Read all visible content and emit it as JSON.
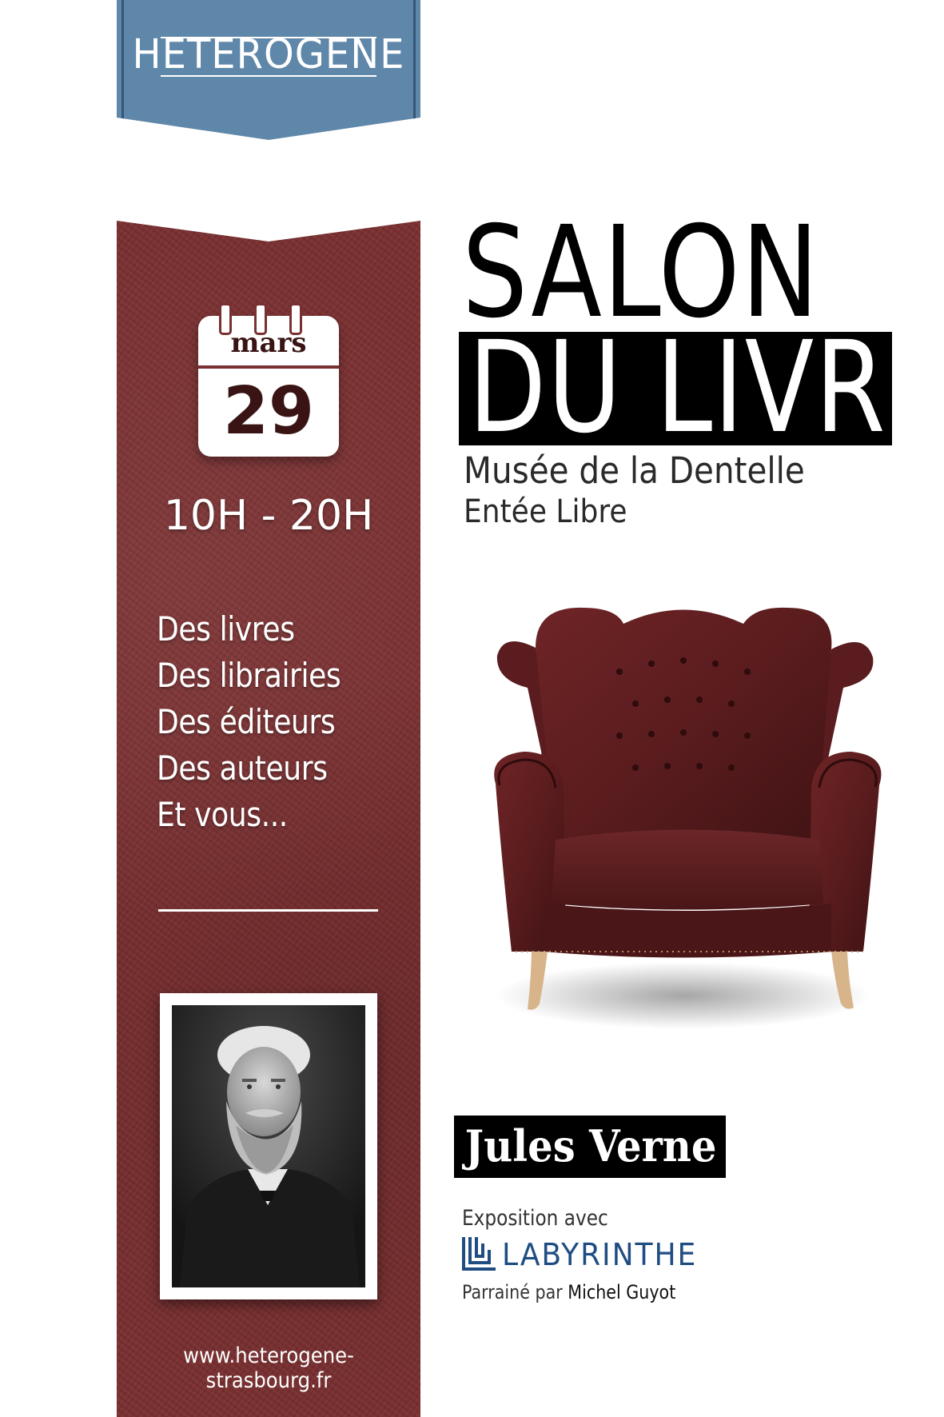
{
  "brand": {
    "name": "HETEROGENE"
  },
  "event": {
    "title_line1": "SALON",
    "title_line2": "DU LIVRE",
    "venue": "Musée de la Dentelle",
    "entry": "Entée Libre",
    "date": {
      "month": "mars",
      "day": "29"
    },
    "hours": "10H - 20H"
  },
  "features": [
    "Des livres",
    "Des librairies",
    "Des éditeurs",
    "Des auteurs",
    "Et vous..."
  ],
  "featured_author": "Jules Verne",
  "exhibition": {
    "label": "Exposition avec",
    "partner": "LABYRINTHE"
  },
  "sponsor": {
    "prefix": "Parrainé par",
    "name": "Michel Guyot"
  },
  "website": "www.heterogene-strasbourg.fr",
  "colors": {
    "banner_blue": "#5f87a9",
    "leather_red": "#7a2f30",
    "partner_blue": "#1f4d82",
    "title_black": "#000000"
  },
  "icons": [
    "calendar-icon",
    "armchair-image",
    "labyrinth-logo-icon",
    "portrait-photo"
  ]
}
